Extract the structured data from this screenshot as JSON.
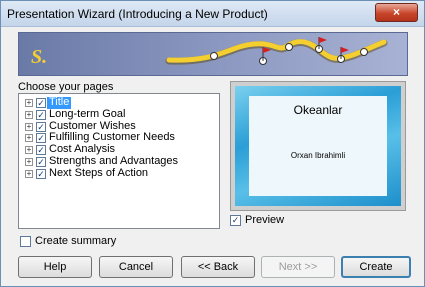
{
  "window": {
    "title": "Presentation Wizard (Introducing a New Product)",
    "close_icon": "×"
  },
  "banner": {
    "logo_text": "S."
  },
  "pages": {
    "label": "Choose your pages",
    "items": [
      {
        "label": "Title",
        "checked": true,
        "selected": true
      },
      {
        "label": "Long-term Goal",
        "checked": true
      },
      {
        "label": "Customer Wishes",
        "checked": true
      },
      {
        "label": "Fulfilling Customer Needs",
        "checked": true
      },
      {
        "label": "Cost Analysis",
        "checked": true
      },
      {
        "label": "Strengths and Advantages",
        "checked": true
      },
      {
        "label": "Next Steps of Action",
        "checked": true
      }
    ]
  },
  "preview": {
    "slide_title": "Okeanlar",
    "slide_subtitle": "Orxan Ibrahimli",
    "checkbox_label": "Preview",
    "checked": true
  },
  "summary": {
    "label": "Create summary",
    "checked": false
  },
  "buttons": {
    "help": "Help",
    "cancel": "Cancel",
    "back": "<< Back",
    "next": "Next >>",
    "create": "Create"
  },
  "colors": {
    "selection": "#3399ff",
    "banner": "#8794bd",
    "track": "#f4cf2f"
  }
}
